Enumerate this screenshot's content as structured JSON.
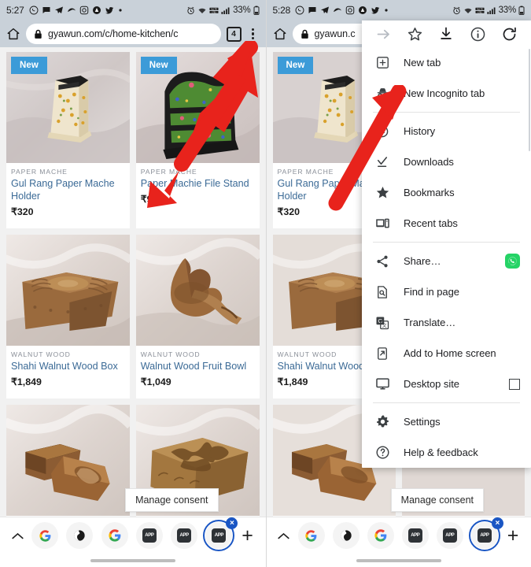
{
  "left_panel": {
    "status_bar": {
      "time": "5:27",
      "battery": "33%",
      "network": "LTE",
      "icons": [
        "whatsapp-icon",
        "messages-icon",
        "telegram-icon",
        "signal-icon",
        "instagram-icon",
        "adblock-icon",
        "twitter-icon",
        "more-dot-icon"
      ],
      "right_icons": [
        "alarm-icon",
        "wifi-icon",
        "volte-icon",
        "signal-bars-icon",
        "battery-icon"
      ]
    },
    "omnibox": {
      "home_icon": "home-icon",
      "lock_icon": "lock-icon",
      "url": "gyawun.com/c/home-kitchen/c",
      "tab_count": "4",
      "menu_icon": "three-dot-menu-icon"
    },
    "products": [
      {
        "badge": "New",
        "brand": "PAPER MACHE",
        "name": "Gul Rang Paper Mache Holder",
        "price": "₹320",
        "img": "papermache-pen-holder"
      },
      {
        "badge": "New",
        "brand": "PAPER MACHE",
        "name": "Paper Machie File Stand",
        "price": "₹999",
        "img": "papermache-file-stand"
      },
      {
        "badge": "",
        "brand": "WALNUT WOOD",
        "name": "Shahi Walnut Wood Box",
        "price": "₹1,849",
        "img": "walnut-carved-box"
      },
      {
        "badge": "",
        "brand": "WALNUT WOOD",
        "name": "Walnut Wood Fruit Bowl",
        "price": "₹1,049",
        "img": "walnut-leaf-bowl"
      },
      {
        "badge": "",
        "brand": "",
        "name": "",
        "price": "",
        "img": "walnut-open-box"
      },
      {
        "badge": "",
        "brand": "",
        "name": "",
        "price": "",
        "img": "walnut-floral-box"
      }
    ],
    "consent_tooltip": "Manage consent",
    "bottom_bar": {
      "expand_icon": "chevron-up-icon",
      "new_tab_icon": "plus-icon",
      "tabs": [
        {
          "icon": "google-g-icon",
          "active": false,
          "label": ""
        },
        {
          "icon": "globe-dark-icon",
          "active": false,
          "label": ""
        },
        {
          "icon": "google-g-icon",
          "active": false,
          "label": ""
        },
        {
          "icon": "app-square-icon",
          "active": false,
          "label": "APP"
        },
        {
          "icon": "app-square-icon",
          "active": false,
          "label": "APP"
        },
        {
          "icon": "app-square-icon",
          "active": true,
          "label": "APP",
          "close": "×"
        }
      ]
    }
  },
  "right_panel": {
    "status_bar": {
      "time": "5:28",
      "battery": "33%",
      "network": "LTE"
    },
    "omnibox": {
      "home_icon": "home-icon",
      "lock_icon": "lock-icon",
      "url": "gyawun.c"
    },
    "menu": {
      "top_actions": [
        {
          "icon": "forward-arrow-icon",
          "name": "forward",
          "disabled": true
        },
        {
          "icon": "star-icon",
          "name": "bookmark",
          "disabled": false
        },
        {
          "icon": "download-icon",
          "name": "download",
          "disabled": false
        },
        {
          "icon": "info-icon",
          "name": "page-info",
          "disabled": false
        },
        {
          "icon": "reload-icon",
          "name": "reload",
          "disabled": false
        }
      ],
      "items": [
        {
          "label": "New tab",
          "icon": "new-tab-icon",
          "group": 1
        },
        {
          "label": "New Incognito tab",
          "icon": "incognito-icon",
          "group": 1
        },
        {
          "label": "History",
          "icon": "history-icon",
          "group": 2
        },
        {
          "label": "Downloads",
          "icon": "downloads-icon",
          "group": 2
        },
        {
          "label": "Bookmarks",
          "icon": "bookmarks-star-icon",
          "group": 2
        },
        {
          "label": "Recent tabs",
          "icon": "recent-tabs-icon",
          "group": 2
        },
        {
          "label": "Share…",
          "icon": "share-icon",
          "group": 3,
          "trailing": "whatsapp-icon"
        },
        {
          "label": "Find in page",
          "icon": "find-in-page-icon",
          "group": 3
        },
        {
          "label": "Translate…",
          "icon": "translate-icon",
          "group": 3
        },
        {
          "label": "Add to Home screen",
          "icon": "add-to-home-icon",
          "group": 3
        },
        {
          "label": "Desktop site",
          "icon": "desktop-site-icon",
          "group": 3,
          "trailing": "checkbox-unchecked"
        },
        {
          "label": "Settings",
          "icon": "settings-gear-icon",
          "group": 4
        },
        {
          "label": "Help & feedback",
          "icon": "help-icon",
          "group": 4
        }
      ]
    },
    "products": [
      {
        "badge": "New",
        "brand": "PAPER MACHE",
        "name": "Gul Rang Paper Mache Holder",
        "price": "₹320",
        "img": "papermache-pen-holder"
      },
      {
        "badge": "",
        "brand": "WALNUT WOOD",
        "name": "Shahi Walnut Wood",
        "price": "₹1,849",
        "img": "walnut-carved-box"
      },
      {
        "badge": "",
        "brand": "",
        "name": "",
        "price": "",
        "img": "walnut-open-box"
      }
    ],
    "consent_tooltip": "Manage consent",
    "bottom_bar": {
      "expand_icon": "chevron-up-icon",
      "new_tab_icon": "plus-icon",
      "tabs": [
        {
          "icon": "google-g-icon",
          "active": false,
          "label": ""
        },
        {
          "icon": "globe-dark-icon",
          "active": false,
          "label": ""
        },
        {
          "icon": "google-g-icon",
          "active": false,
          "label": ""
        },
        {
          "icon": "app-square-icon",
          "active": false,
          "label": "APP"
        },
        {
          "icon": "app-square-icon",
          "active": false,
          "label": "APP"
        },
        {
          "icon": "app-square-icon",
          "active": true,
          "label": "APP",
          "close": "×"
        }
      ]
    }
  },
  "annotations": {
    "arrow_color": "#e8231c",
    "arrows": [
      {
        "name": "arrow-to-menu-button",
        "target": "three-dot-menu-icon"
      },
      {
        "name": "arrow-to-incognito-item",
        "target": "New Incognito tab"
      }
    ]
  },
  "colors": {
    "status_bar_bg": "#c9d1d9",
    "badge_blue": "#3c9bd8",
    "link_blue": "#3b6a96",
    "accent_blue": "#1a56c4",
    "whatsapp_green": "#25d366",
    "page_bg": "#f1f1f1"
  }
}
